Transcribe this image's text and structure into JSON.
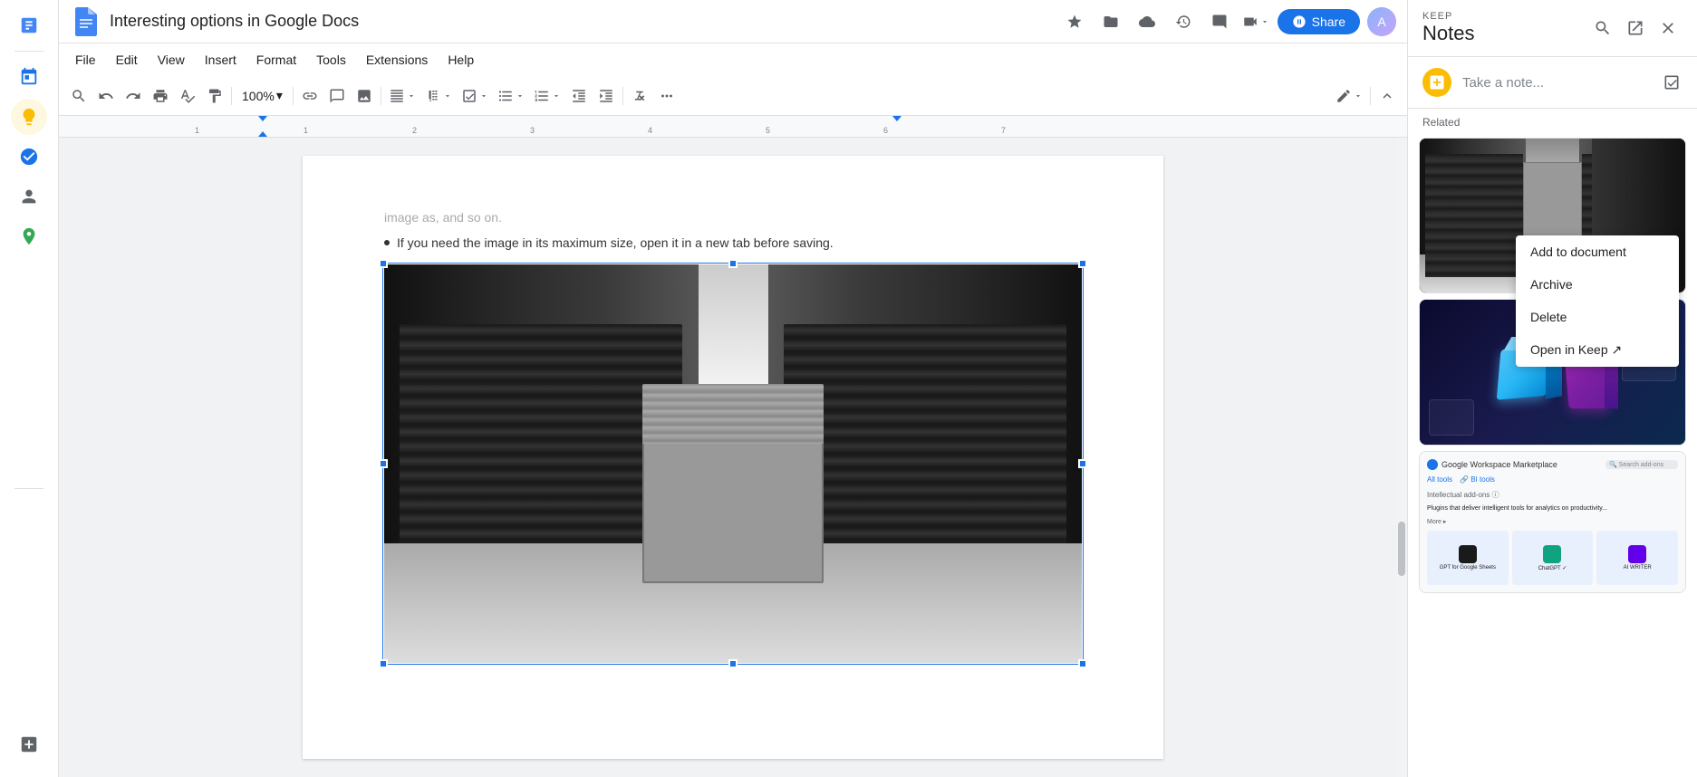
{
  "titlebar": {
    "doc_title": "Interesting options in Google Docs",
    "share_label": "Share"
  },
  "menubar": {
    "items": [
      "File",
      "Edit",
      "View",
      "Insert",
      "Format",
      "Tools",
      "Extensions",
      "Help"
    ]
  },
  "toolbar": {
    "zoom_value": "100%",
    "zoom_arrow": "▾"
  },
  "doc": {
    "faded_text": "image as, and so on.",
    "bullet_text": "If you need the image in its maximum size, open it in a new tab before saving."
  },
  "keep": {
    "label": "KEEP",
    "name": "Notes",
    "take_note_placeholder": "Take a note...",
    "related_label": "Related"
  },
  "context_menu": {
    "items": [
      "Add to document",
      "Archive",
      "Delete",
      "Open in Keep ↗"
    ]
  },
  "sidebar_apps": {
    "calendar_icon": "📅",
    "keep_icon": "💛",
    "tasks_icon": "✓",
    "contacts_icon": "👤",
    "maps_icon": "🗺"
  }
}
